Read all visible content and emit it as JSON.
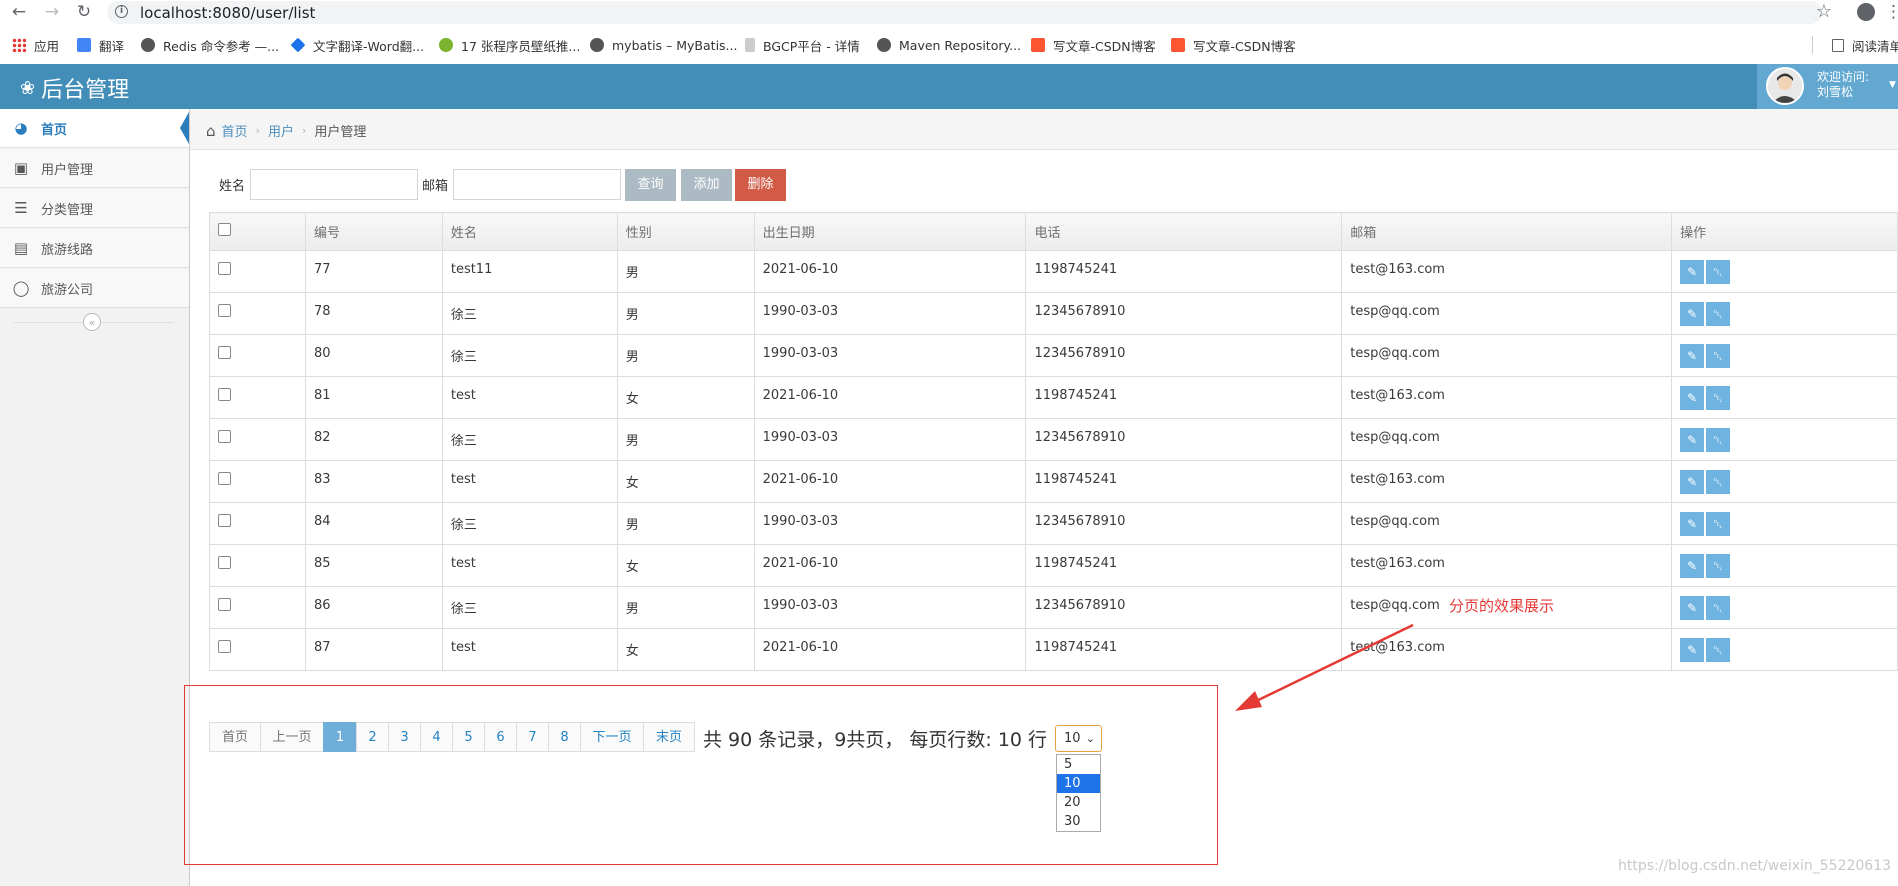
{
  "browser": {
    "url": "localhost:8080/user/list",
    "bookmarks": [
      {
        "label": "应用",
        "icon": "apps-grid-icon"
      },
      {
        "label": "翻译",
        "icon": "translate-icon"
      },
      {
        "label": "Redis 命令参考 —...",
        "icon": "globe-icon"
      },
      {
        "label": "文字翻译-Word翻...",
        "icon": "diamond-icon"
      },
      {
        "label": "17 张程序员壁纸推...",
        "icon": "wechat-icon"
      },
      {
        "label": "mybatis – MyBatis...",
        "icon": "globe-icon"
      },
      {
        "label": "BGCP平台 - 详情",
        "icon": "plugin-icon"
      },
      {
        "label": "Maven Repository...",
        "icon": "globe-icon"
      },
      {
        "label": "写文章-CSDN博客",
        "icon": "csdn-icon"
      },
      {
        "label": "写文章-CSDN博客",
        "icon": "csdn-icon"
      }
    ],
    "reading_list": "阅读清单"
  },
  "header": {
    "brand": "后台管理",
    "welcome_line1": "欢迎访问:",
    "welcome_line2": "刘雪松"
  },
  "sidebar": {
    "items": [
      {
        "label": "首页",
        "icon": "dashboard-icon",
        "active": true
      },
      {
        "label": "用户管理",
        "icon": "desktop-icon"
      },
      {
        "label": "分类管理",
        "icon": "list-icon"
      },
      {
        "label": "旅游线路",
        "icon": "picture-icon"
      },
      {
        "label": "旅游公司",
        "icon": "comment-icon"
      }
    ]
  },
  "breadcrumb": {
    "home": "首页",
    "level2": "用户",
    "current": "用户管理"
  },
  "search": {
    "name_label": "姓名",
    "email_label": "邮箱",
    "name_value": "",
    "email_value": "",
    "query_label": "查询",
    "add_label": "添加",
    "delete_label": "删除"
  },
  "table": {
    "headers": [
      "编号",
      "姓名",
      "性别",
      "出生日期",
      "电话",
      "邮箱",
      "操作"
    ],
    "rows": [
      [
        "77",
        "test11",
        "男",
        "2021-06-10",
        "1198745241",
        "test@163.com"
      ],
      [
        "78",
        "徐三",
        "男",
        "1990-03-03",
        "12345678910",
        "tesp@qq.com"
      ],
      [
        "80",
        "徐三",
        "男",
        "1990-03-03",
        "12345678910",
        "tesp@qq.com"
      ],
      [
        "81",
        "test",
        "女",
        "2021-06-10",
        "1198745241",
        "test@163.com"
      ],
      [
        "82",
        "徐三",
        "男",
        "1990-03-03",
        "12345678910",
        "tesp@qq.com"
      ],
      [
        "83",
        "test",
        "女",
        "2021-06-10",
        "1198745241",
        "test@163.com"
      ],
      [
        "84",
        "徐三",
        "男",
        "1990-03-03",
        "12345678910",
        "tesp@qq.com"
      ],
      [
        "85",
        "test",
        "女",
        "2021-06-10",
        "1198745241",
        "test@163.com"
      ],
      [
        "86",
        "徐三",
        "男",
        "1990-03-03",
        "12345678910",
        "tesp@qq.com"
      ],
      [
        "87",
        "test",
        "女",
        "2021-06-10",
        "1198745241",
        "test@163.com"
      ]
    ]
  },
  "pagination": {
    "first": "首页",
    "prev": "上一页",
    "pages": [
      "1",
      "2",
      "3",
      "4",
      "5",
      "6",
      "7",
      "8"
    ],
    "current_page": "1",
    "next": "下一页",
    "last": "末页",
    "info": "共 90 条记录，9共页， 每页行数: 10 行",
    "page_size_selected": "10",
    "page_size_options": [
      "5",
      "10",
      "20",
      "30"
    ]
  },
  "annotation": {
    "text": "分页的效果展示",
    "color": "#e53935"
  },
  "watermark": "https://blog.csdn.net/weixin_55220613",
  "colors": {
    "header": "#438eb9",
    "active_link": "#2b7dbc",
    "delete_button": "#d15b47",
    "op_button": "#6fb3e0",
    "pager_active": "#6faed9"
  }
}
